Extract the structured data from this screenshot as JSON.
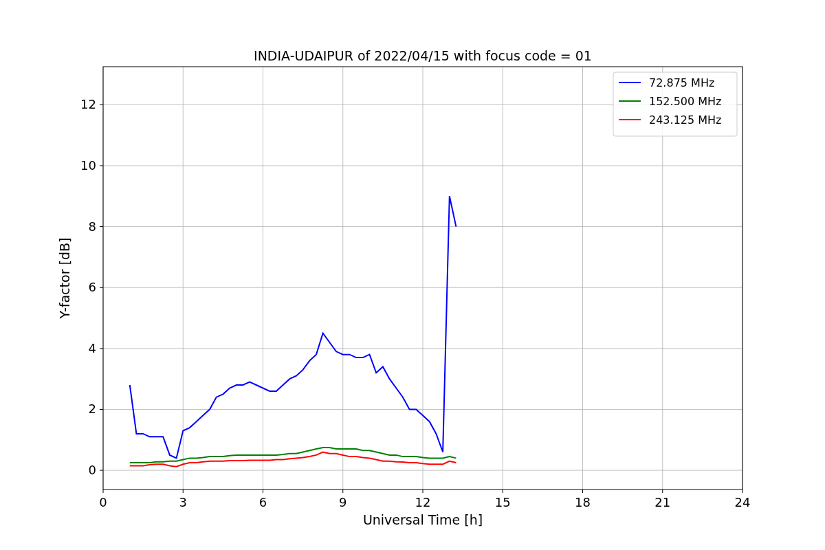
{
  "figure": {
    "chart_data": {
      "type": "line",
      "title": "INDIA-UDAIPUR of 2022/04/15 with focus code = 01",
      "xlabel": "Universal Time [h]",
      "ylabel": "Y-factor [dB]",
      "x": [
        1.0,
        1.25,
        1.5,
        1.75,
        2.0,
        2.25,
        2.5,
        2.75,
        3.0,
        3.25,
        3.5,
        3.75,
        4.0,
        4.25,
        4.5,
        4.75,
        5.0,
        5.25,
        5.5,
        5.75,
        6.0,
        6.25,
        6.5,
        6.75,
        7.0,
        7.25,
        7.5,
        7.75,
        8.0,
        8.25,
        8.5,
        8.75,
        9.0,
        9.25,
        9.5,
        9.75,
        10.0,
        10.25,
        10.5,
        10.75,
        11.0,
        11.25,
        11.5,
        11.75,
        12.0,
        12.25,
        12.5,
        12.75,
        13.0,
        13.25
      ],
      "series": [
        {
          "name": "72.875 MHz",
          "color": "#0000ff",
          "values": [
            2.8,
            1.2,
            1.2,
            1.1,
            1.1,
            1.1,
            0.5,
            0.4,
            1.3,
            1.4,
            1.6,
            1.8,
            2.0,
            2.4,
            2.5,
            2.7,
            2.8,
            2.8,
            2.9,
            2.8,
            2.7,
            2.6,
            2.6,
            2.8,
            3.0,
            3.1,
            3.3,
            3.6,
            3.8,
            4.5,
            4.2,
            3.9,
            3.8,
            3.8,
            3.7,
            3.7,
            3.8,
            3.2,
            3.4,
            3.0,
            2.7,
            2.4,
            2.0,
            2.0,
            1.8,
            1.6,
            1.2,
            0.6,
            9.0,
            8.0
          ]
        },
        {
          "name": "152.500 MHz",
          "color": "#008000",
          "values": [
            0.25,
            0.25,
            0.25,
            0.25,
            0.28,
            0.28,
            0.3,
            0.3,
            0.35,
            0.4,
            0.4,
            0.42,
            0.45,
            0.45,
            0.45,
            0.48,
            0.5,
            0.5,
            0.5,
            0.5,
            0.5,
            0.5,
            0.5,
            0.52,
            0.55,
            0.55,
            0.6,
            0.65,
            0.7,
            0.75,
            0.75,
            0.7,
            0.7,
            0.7,
            0.7,
            0.65,
            0.65,
            0.6,
            0.55,
            0.5,
            0.5,
            0.45,
            0.45,
            0.45,
            0.42,
            0.4,
            0.4,
            0.4,
            0.45,
            0.4
          ]
        },
        {
          "name": "243.125 MHz",
          "color": "#ff0000",
          "values": [
            0.15,
            0.15,
            0.15,
            0.18,
            0.2,
            0.2,
            0.15,
            0.12,
            0.2,
            0.25,
            0.25,
            0.28,
            0.3,
            0.3,
            0.3,
            0.32,
            0.32,
            0.32,
            0.33,
            0.33,
            0.33,
            0.33,
            0.35,
            0.35,
            0.38,
            0.4,
            0.42,
            0.45,
            0.5,
            0.6,
            0.55,
            0.55,
            0.5,
            0.45,
            0.45,
            0.42,
            0.4,
            0.35,
            0.3,
            0.3,
            0.28,
            0.27,
            0.25,
            0.25,
            0.22,
            0.2,
            0.2,
            0.2,
            0.3,
            0.25
          ]
        }
      ],
      "grid": true,
      "legend": true,
      "xlim": [
        0,
        24
      ],
      "ylim": [
        -0.63,
        13.25
      ],
      "xticks": [
        0,
        3,
        6,
        9,
        12,
        15,
        18,
        21,
        24
      ],
      "yticks": [
        0,
        2,
        4,
        6,
        8,
        10,
        12
      ]
    }
  }
}
